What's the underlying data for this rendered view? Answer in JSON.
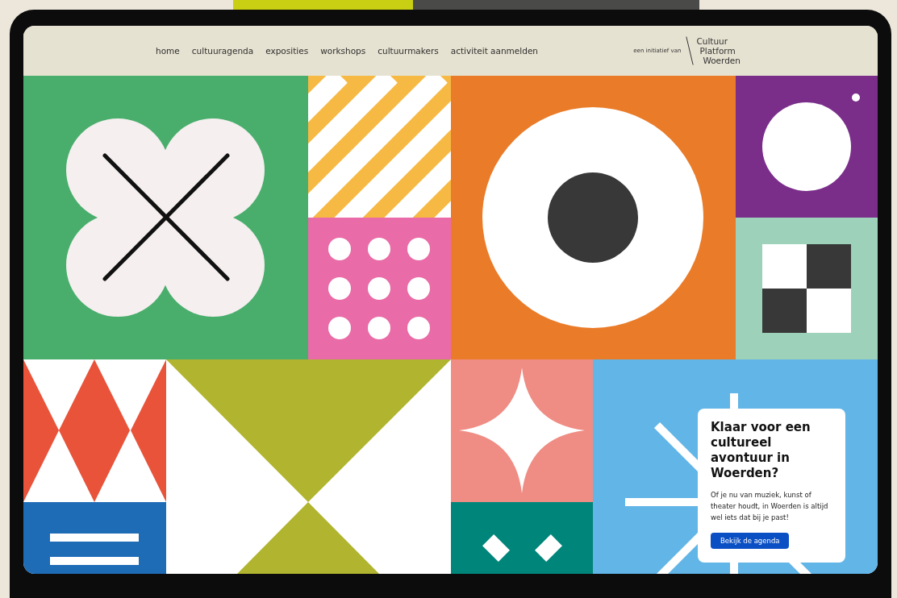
{
  "nav": {
    "items": [
      {
        "label": "home"
      },
      {
        "label": "cultuuragenda"
      },
      {
        "label": "exposities"
      },
      {
        "label": "workshops"
      },
      {
        "label": "cultuurmakers"
      },
      {
        "label": "activiteit aanmelden"
      }
    ]
  },
  "logo": {
    "prefix": "een initiatief van",
    "lines": [
      "Cultuur",
      "Platform",
      "Woerden"
    ]
  },
  "card": {
    "title": "Klaar voor een cultureel avontuur in Woerden?",
    "text": "Of je nu van muziek, kunst of theater houdt, in Woerden is altijd wel iets dat bij je past!",
    "button": "Bekijk de agenda"
  }
}
